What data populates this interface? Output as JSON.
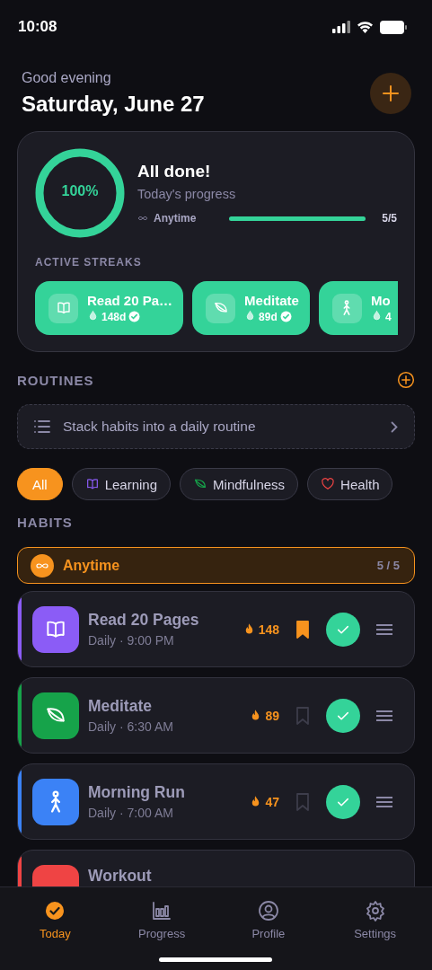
{
  "status_bar": {
    "time": "10:08"
  },
  "header": {
    "greeting": "Good evening",
    "date": "Saturday, June 27"
  },
  "summary": {
    "percent": "100%",
    "title": "All done!",
    "subtitle": "Today's progress",
    "groups": [
      {
        "label": "Anytime",
        "level": 1,
        "count": "5/5"
      }
    ],
    "streaks_label": "ACTIVE STREAKS",
    "streaks": [
      {
        "name": "Read 20 Pa…",
        "days": "148d",
        "kind": "book",
        "verified": true
      },
      {
        "name": "Meditate",
        "days": "89d",
        "kind": "leaf",
        "verified": true
      },
      {
        "name": "Mo",
        "days": "4",
        "kind": "runner",
        "verified": false
      }
    ]
  },
  "routines": {
    "title": "ROUTINES",
    "prompt": "Stack habits into a daily routine"
  },
  "filters": [
    {
      "label": "All",
      "kind": "all",
      "selected": true
    },
    {
      "label": "Learning",
      "kind": "book",
      "selected": false
    },
    {
      "label": "Mindfulness",
      "kind": "leaf",
      "selected": false
    },
    {
      "label": "Health",
      "kind": "heart",
      "selected": false
    }
  ],
  "habits": {
    "title": "HABITS",
    "group": {
      "label": "Anytime",
      "count": "5 / 5"
    },
    "items": [
      {
        "name": "Read 20 Pages",
        "schedule": "Daily · 9:00 PM",
        "streak": "148",
        "kind": "book",
        "color": "#8b5cf6",
        "bookmarked": true,
        "done": true
      },
      {
        "name": "Meditate",
        "schedule": "Daily · 6:30 AM",
        "streak": "89",
        "kind": "leaf",
        "color": "#16a34a",
        "bookmarked": false,
        "done": true
      },
      {
        "name": "Morning Run",
        "schedule": "Daily · 7:00 AM",
        "streak": "47",
        "kind": "runner",
        "color": "#3b82f6",
        "bookmarked": false,
        "done": true
      },
      {
        "name": "Workout",
        "color": "#ef4444"
      }
    ]
  },
  "nav": [
    {
      "label": "Today",
      "kind": "today",
      "selected": true
    },
    {
      "label": "Progress",
      "kind": "chart",
      "selected": false
    },
    {
      "label": "Profile",
      "kind": "person",
      "selected": false
    },
    {
      "label": "Settings",
      "kind": "gear",
      "selected": false
    }
  ]
}
